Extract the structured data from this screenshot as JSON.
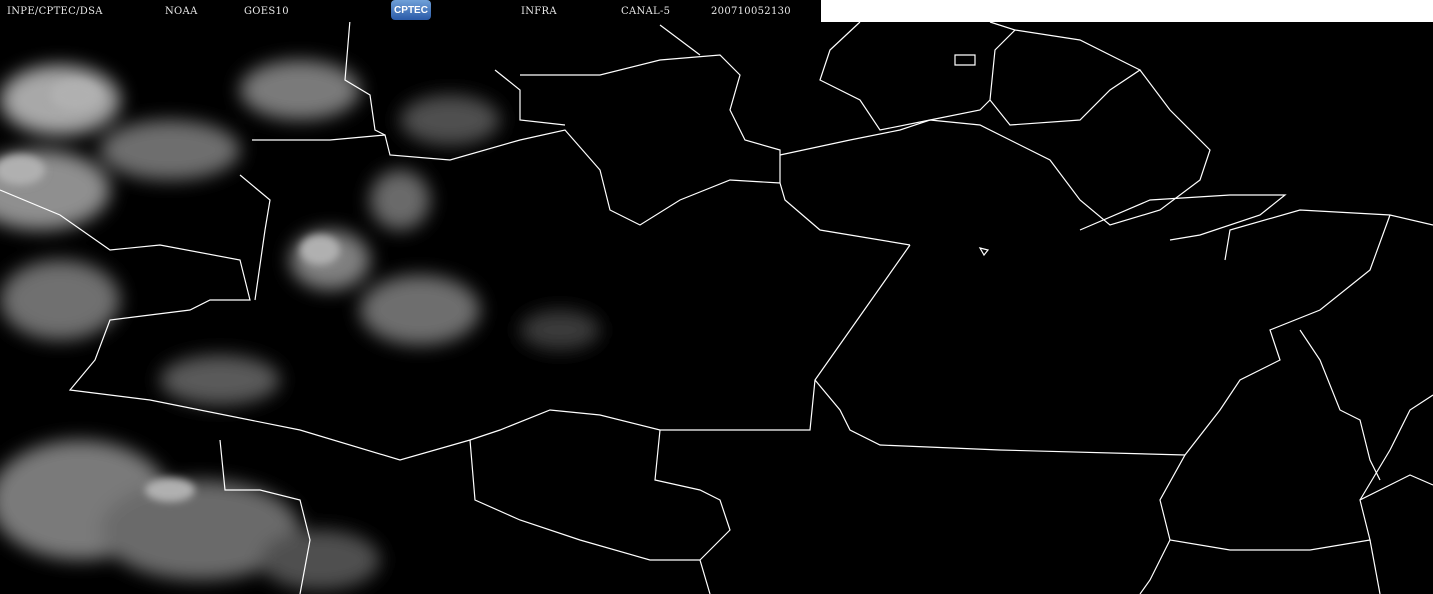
{
  "header": {
    "institution": "INPE/CPTEC/DSA",
    "agency": "NOAA",
    "satellite": "GOES10",
    "logo": "CPTEC",
    "product": "INFRA",
    "channel": "CANAL-5",
    "timestamp": "200710052130"
  },
  "colors": {
    "background": "#000000",
    "borders": "#ffffff",
    "clouds": "#9a9a9a"
  }
}
